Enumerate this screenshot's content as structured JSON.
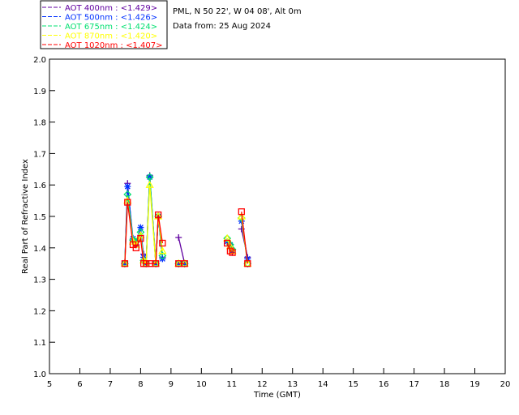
{
  "header": {
    "site": "PML, N 50 22', W 04 08', Alt 0m",
    "date": "Data from: 25 Aug 2024"
  },
  "chart_data": {
    "type": "line",
    "title": "",
    "xlabel": "Time (GMT)",
    "ylabel": "Real Part of Refractive Index",
    "xlim": [
      5,
      20
    ],
    "ylim": [
      1.0,
      2.0
    ],
    "xticks": [
      "5",
      "6",
      "7",
      "8",
      "9",
      "10",
      "11",
      "12",
      "13",
      "14",
      "15",
      "16",
      "17",
      "18",
      "19",
      "20"
    ],
    "yticks": [
      "1.0",
      "1.1",
      "1.2",
      "1.3",
      "1.4",
      "1.5",
      "1.6",
      "1.7",
      "1.8",
      "1.9",
      "2.0"
    ],
    "grid": false,
    "legend_position": "top-left",
    "x": [
      7.48,
      7.57,
      7.75,
      7.85,
      8.0,
      8.1,
      8.18,
      8.3,
      8.5,
      8.58,
      8.72,
      null,
      9.25,
      9.45,
      null,
      10.85,
      10.95,
      11.02,
      null,
      11.32,
      11.52
    ],
    "series": [
      {
        "name": "AOT  400nm : <1.429>",
        "color": "#6000a0",
        "marker": "plus",
        "values": [
          1.35,
          1.605,
          1.42,
          1.42,
          1.44,
          1.38,
          1.35,
          1.63,
          1.35,
          1.5,
          1.37,
          null,
          1.433,
          1.35,
          null,
          1.42,
          1.41,
          1.385,
          null,
          1.46,
          1.37
        ]
      },
      {
        "name": "AOT  500nm : <1.426>",
        "color": "#0030ff",
        "marker": "asterisk",
        "values": [
          1.35,
          1.595,
          1.43,
          1.41,
          1.465,
          1.37,
          1.35,
          1.625,
          1.35,
          1.5,
          1.365,
          null,
          1.35,
          1.35,
          null,
          1.42,
          1.41,
          1.39,
          null,
          1.485,
          1.365
        ]
      },
      {
        "name": "AOT  675nm : <1.424>",
        "color": "#00e070",
        "marker": "diamond",
        "values": [
          1.35,
          1.57,
          1.425,
          1.42,
          1.45,
          1.36,
          1.35,
          1.625,
          1.35,
          1.5,
          1.375,
          null,
          1.35,
          1.35,
          null,
          1.43,
          1.41,
          1.395,
          null,
          1.495,
          1.35
        ]
      },
      {
        "name": "AOT  870nm : <1.420>",
        "color": "#ffff00",
        "marker": "triangle",
        "values": [
          1.35,
          1.55,
          1.42,
          1.41,
          1.44,
          1.36,
          1.35,
          1.6,
          1.35,
          1.5,
          1.39,
          null,
          1.35,
          1.35,
          null,
          1.43,
          1.405,
          1.39,
          null,
          1.5,
          1.35
        ]
      },
      {
        "name": "AOT 1020nm : <1.407>",
        "color": "#ff0000",
        "marker": "square",
        "values": [
          1.35,
          1.545,
          1.41,
          1.4,
          1.43,
          1.35,
          1.35,
          1.35,
          1.35,
          1.505,
          1.415,
          null,
          1.35,
          1.35,
          null,
          1.415,
          1.39,
          1.385,
          null,
          1.515,
          1.35
        ]
      }
    ]
  }
}
